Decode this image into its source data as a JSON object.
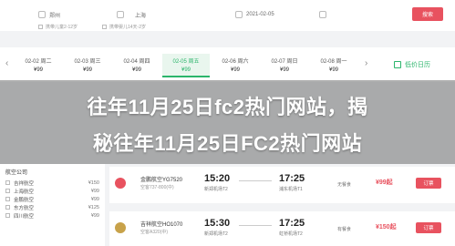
{
  "search": {
    "from": "郑州",
    "to": "上海",
    "date": "2021-02-05",
    "return_placeholder": "",
    "button": "搜索",
    "options": [
      "携带儿童2-12岁",
      "携带婴儿14天-2岁"
    ]
  },
  "dates": [
    {
      "date": "02-02 周二",
      "price": "¥99"
    },
    {
      "date": "02-03 周三",
      "price": "¥99"
    },
    {
      "date": "02-04 周四",
      "price": "¥99"
    },
    {
      "date": "02-05 周五",
      "price": "¥99"
    },
    {
      "date": "02-06 周六",
      "price": "¥99"
    },
    {
      "date": "02-07 周日",
      "price": "¥99"
    },
    {
      "date": "02-08 周一",
      "price": "¥99"
    }
  ],
  "active_date_index": 3,
  "lowprice_label": "低价日历",
  "headline": {
    "line1": "往年11月25日fc2热门网站，揭",
    "line2": "秘往年11月25日FC2热门网站"
  },
  "sidebar": {
    "title": "航空公司",
    "items": [
      {
        "label": "吉祥航空",
        "price": "¥150"
      },
      {
        "label": "上海航空",
        "price": "¥99"
      },
      {
        "label": "金鹏航空",
        "price": "¥99"
      },
      {
        "label": "东方航空",
        "price": "¥125"
      },
      {
        "label": "四川航空",
        "price": "¥99"
      }
    ]
  },
  "flights": [
    {
      "airline": "金鹏航空YG7520",
      "aircraft": "空客737-800(中)",
      "dep_time": "15:20",
      "dep_airport": "新郑机场T2",
      "arr_time": "17:25",
      "arr_airport": "浦东机场T1",
      "meal": "无餐食",
      "price": "¥99起",
      "book": "订票",
      "color": "#e8525f"
    },
    {
      "airline": "吉祥航空HO1070",
      "aircraft": "空客A320(中)",
      "dep_time": "15:30",
      "dep_airport": "新郑机场T2",
      "arr_time": "17:25",
      "arr_airport": "虹桥机场T2",
      "meal": "有餐食",
      "price": "¥150起",
      "book": "订票",
      "color": "#c8a24a"
    }
  ]
}
